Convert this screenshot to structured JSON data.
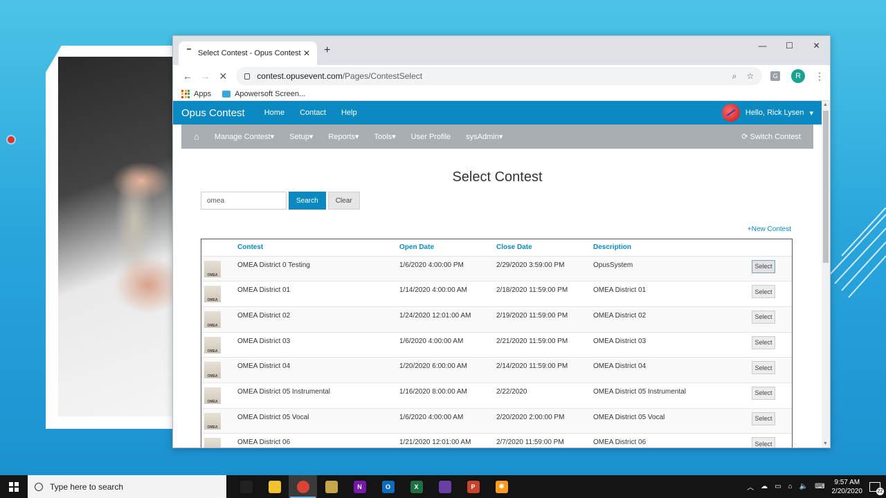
{
  "browser": {
    "tab_title": "Select Contest - Opus Contest",
    "tab_close": "✕",
    "new_tab": "+",
    "url_host": "contest.opusevent.com",
    "url_path": "/Pages/ContestSelect",
    "profile_initial": "R",
    "extension_label": "G",
    "bookmarks": [
      "Apps",
      "Apowersoft Screen..."
    ]
  },
  "site": {
    "brand": "Opus Contest",
    "nav_links": [
      "Home",
      "Contact",
      "Help"
    ],
    "user_greeting": "Hello, Rick Lysen",
    "subnav_items": [
      "Manage Contest",
      "Setup",
      "Reports",
      "Tools",
      "User Profile",
      "sysAdmin"
    ],
    "switch_contest": "Switch Contest"
  },
  "page": {
    "title": "Select Contest",
    "search_value": "omea",
    "search_button": "Search",
    "clear_button": "Clear",
    "new_contest": "+New Contest",
    "columns": [
      "Contest",
      "Open Date",
      "Close Date",
      "Description"
    ],
    "select_label": "Select",
    "logo_text": "OMEA",
    "rows": [
      {
        "contest": "OMEA District 0 Testing",
        "open": "1/6/2020 4:00:00 PM",
        "close": "2/29/2020 3:59:00 PM",
        "description": "OpusSystem"
      },
      {
        "contest": "OMEA District 01",
        "open": "1/14/2020 4:00:00 AM",
        "close": "2/18/2020 11:59:00 PM",
        "description": "OMEA District 01"
      },
      {
        "contest": "OMEA District 02",
        "open": "1/24/2020 12:01:00 AM",
        "close": "2/19/2020 11:59:00 PM",
        "description": "OMEA District 02"
      },
      {
        "contest": "OMEA District 03",
        "open": "1/6/2020 4:00:00 AM",
        "close": "2/21/2020 11:59:00 PM",
        "description": "OMEA District 03"
      },
      {
        "contest": "OMEA District 04",
        "open": "1/20/2020 6:00:00 AM",
        "close": "2/14/2020 11:59:00 PM",
        "description": "OMEA District 04"
      },
      {
        "contest": "OMEA District 05 Instrumental",
        "open": "1/16/2020 8:00:00 AM",
        "close": "2/22/2020",
        "description": "OMEA District 05 Instrumental"
      },
      {
        "contest": "OMEA District 05 Vocal",
        "open": "1/6/2020 4:00:00 AM",
        "close": "2/20/2020 2:00:00 PM",
        "description": "OMEA District 05 Vocal"
      },
      {
        "contest": "OMEA District 06",
        "open": "1/21/2020 12:01:00 AM",
        "close": "2/7/2020 11:59:00 PM",
        "description": "OMEA District 06"
      }
    ]
  },
  "taskbar": {
    "search_placeholder": "Type here to search",
    "time": "9:57 AM",
    "date": "2/20/2020",
    "notification_count": "22",
    "apps": [
      {
        "name": "snipping-app",
        "color": "#222222",
        "label": ""
      },
      {
        "name": "file-explorer",
        "color": "#f2c230",
        "label": ""
      },
      {
        "name": "chrome",
        "color": "#db4437",
        "label": ""
      },
      {
        "name": "spreadsheet-tool",
        "color": "#c6a64a",
        "label": ""
      },
      {
        "name": "onenote",
        "color": "#7719aa",
        "label": "N"
      },
      {
        "name": "outlook",
        "color": "#0f6cbd",
        "label": "O"
      },
      {
        "name": "excel",
        "color": "#1d7044",
        "label": "X"
      },
      {
        "name": "visual-studio",
        "color": "#6a3fa5",
        "label": ""
      },
      {
        "name": "powerpoint",
        "color": "#c9432a",
        "label": "P"
      },
      {
        "name": "snowflake-app",
        "color": "#ff9b1f",
        "label": "✱"
      }
    ]
  }
}
